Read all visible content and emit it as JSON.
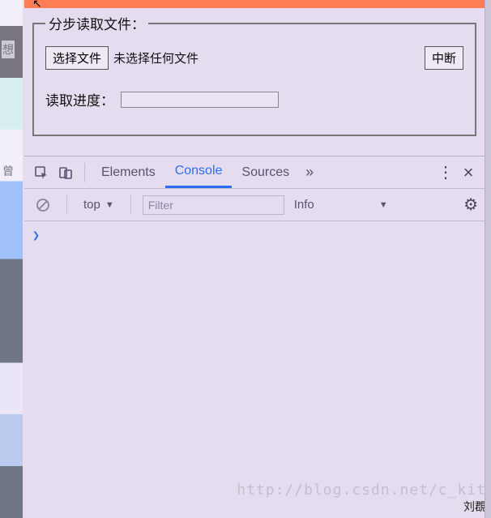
{
  "left_strip": {
    "char1": "想",
    "char2": "曾"
  },
  "top": {
    "cursor": "↖"
  },
  "fieldset": {
    "legend": "分步读取文件：",
    "choose_button": "选择文件",
    "no_file": "未选择任何文件",
    "abort_button": "中断",
    "progress_label": "读取进度："
  },
  "devtools": {
    "tabs": {
      "elements": "Elements",
      "console": "Console",
      "sources": "Sources",
      "more": "»",
      "kebab": "⋮",
      "close": "×"
    },
    "toolbar": {
      "context": "top",
      "context_arrow": "▼",
      "filter_placeholder": "Filter",
      "level": "Info",
      "level_arrow": "▼",
      "gear": "⚙"
    },
    "body": {
      "prompt": "❯"
    }
  },
  "watermark": "http://blog.csdn.net/c_kit",
  "signature": "刘覠"
}
